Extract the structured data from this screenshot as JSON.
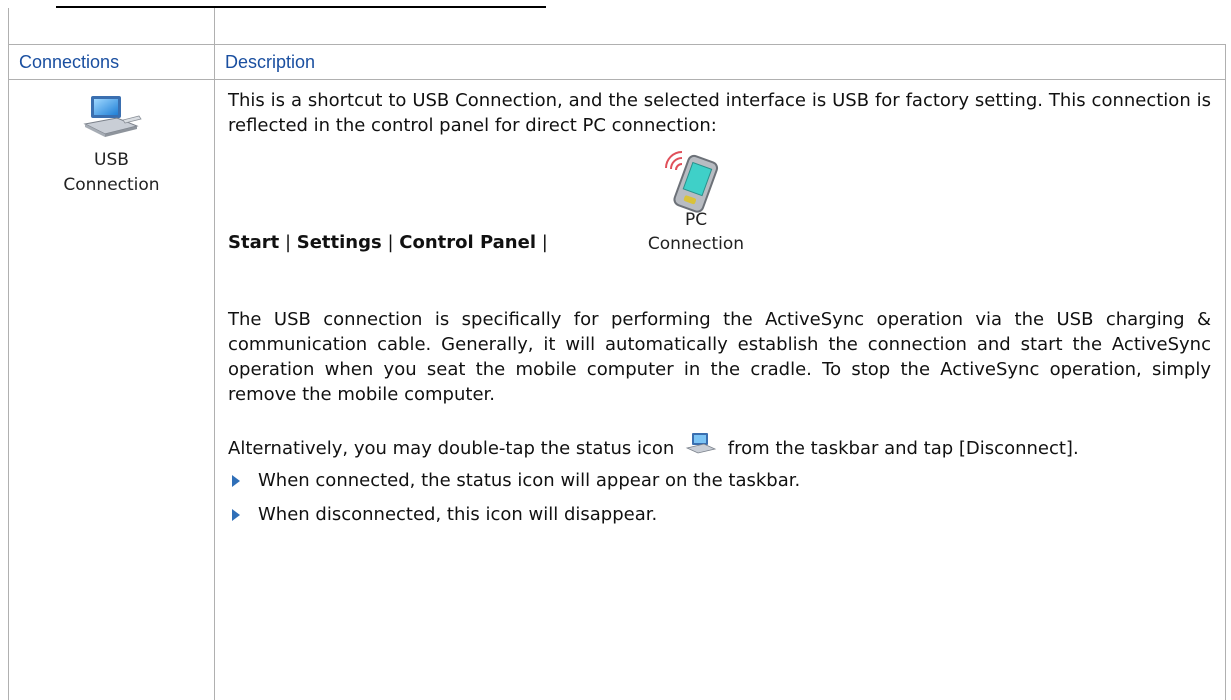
{
  "table": {
    "headers": {
      "connections": "Connections",
      "description": "Description"
    }
  },
  "connection": {
    "icon": "usb-connection-icon",
    "name_line1": "USB",
    "name_line2": "Connection"
  },
  "description": {
    "para1": "This is a shortcut to USB Connection, and the selected interface is USB for factory setting. This connection is reflected in the control panel for direct PC connection:",
    "pc_icon": "pc-connection-icon",
    "pc_caption_line1": "PC",
    "pc_caption_line2": "Connection",
    "path": {
      "start": "Start",
      "settings": "Settings",
      "control_panel": "Control Panel",
      "separator": "|"
    },
    "para2": "The USB connection is specifically for performing the ActiveSync operation via the USB charging & communication cable. Generally, it will automatically establish the connection and start the ActiveSync operation when you seat the mobile computer in the cradle. To stop the ActiveSync operation, simply remove the mobile computer.",
    "para3_before": "Alternatively, you may double-tap the status icon",
    "para3_after": "from the taskbar and tap [Disconnect].",
    "status_icon": "status-connection-icon",
    "bullets": [
      "When connected, the status icon will appear on the taskbar.",
      "When disconnected, this icon will disappear."
    ]
  },
  "colors": {
    "header_text": "#1a4fa0",
    "bullet": "#2f6fb8",
    "border": "#b0b0b0"
  }
}
